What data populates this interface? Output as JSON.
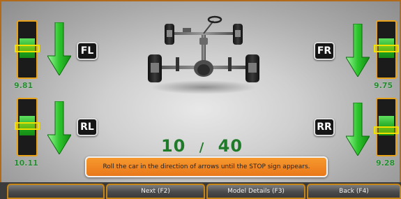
{
  "wheels": {
    "fl": {
      "label": "FL",
      "value": "9.81"
    },
    "fr": {
      "label": "FR",
      "value": "9.75"
    },
    "rl": {
      "label": "RL",
      "value": "10.11"
    },
    "rr": {
      "label": "RR",
      "value": "9.28"
    }
  },
  "counter": {
    "current": "10",
    "separator": "/",
    "total": "40"
  },
  "message": "Roll the car in the direction of arrows until the STOP sign appears.",
  "buttons": {
    "blank": "",
    "next": "Next (F2)",
    "model_details": "Model Details (F3)",
    "back": "Back (F4)"
  },
  "colors": {
    "accent_orange": "#e9781a",
    "gauge_green": "#1ea41e",
    "marker_yellow": "#f0e000",
    "counter_green": "#1f7a2a"
  },
  "icons": [
    "down-arrow-icon",
    "car-chassis-icon"
  ]
}
